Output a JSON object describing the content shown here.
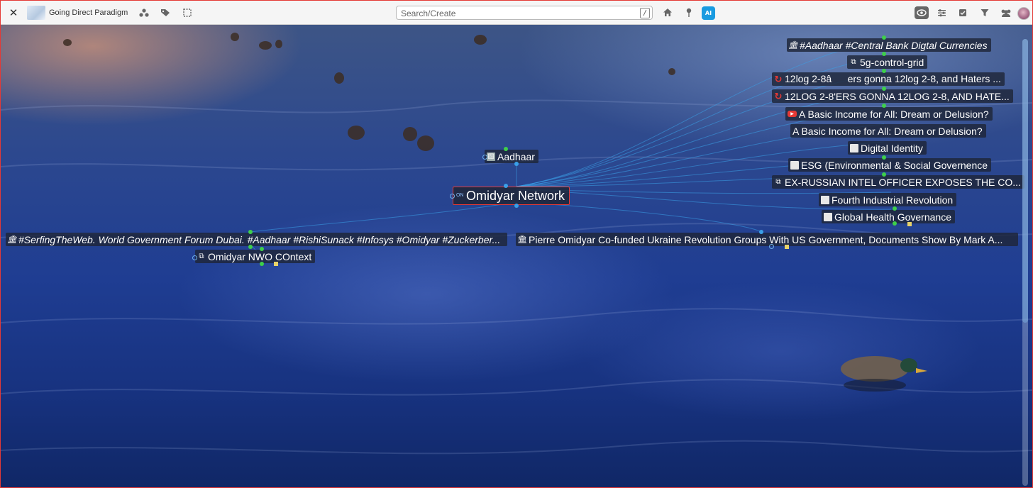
{
  "toolbar": {
    "title": "Going Direct Paradigm",
    "search_placeholder": "Search/Create",
    "search_shortcut": "/",
    "ai_label": "AI"
  },
  "graph": {
    "central_node": "Omidyar Network",
    "central_badge": "ON",
    "nodes": {
      "aadhaar": "Aadhaar",
      "tags_node": "#Aadhaar #Central Bank Digtal Currencies",
      "fiveg": "5g-control-grid",
      "log_lower": "12log 2-8âers gonna 12log 2-8, and Haters ...",
      "log_upper": "12LOG 2-8'ERS GONNA 12LOG 2-8, AND HATE...",
      "basic_income_video": "A Basic Income for All: Dream or Delusion?",
      "basic_income": "A Basic Income for All: Dream or Delusion?",
      "digital_identity": "Digital Identity",
      "esg": "ESG (Environmental & Social Governence",
      "ex_russian": "EX-RUSSIAN INTEL OFFICER EXPOSES THE CO...",
      "fourth_ir": "Fourth Industrial Revolution",
      "global_health": "Global Health Governance",
      "serfing": "#SerfingTheWeb. World Government Forum Dubai. #Aadhaar #RishiSunack #Infosys #Omidyar #Zuckerber...",
      "pierre": "Pierre Omidyar Co-funded Ukraine Revolution Groups With US Government, Documents Show By Mark A...",
      "nwo_context": "Omidyar NWO COntext"
    }
  },
  "colors": {
    "accent_red": "#e53935",
    "link_green": "#3ecf4a",
    "edge_blue": "#3aa0e8",
    "ai_blue": "#1a9be0"
  },
  "icons": {
    "close": "close-icon",
    "graph": "graph-icon",
    "tags": "tags-icon",
    "select": "select-icon",
    "home": "home-icon",
    "pin": "pin-icon",
    "ai": "ai-icon",
    "eye": "eye-icon",
    "settings": "sliders-icon",
    "check": "checkbox-icon",
    "filter": "filter-icon",
    "users": "users-icon"
  }
}
